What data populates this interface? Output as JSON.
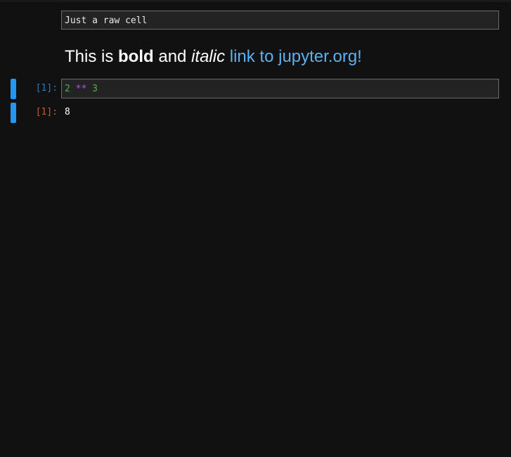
{
  "raw_cell": {
    "text": "Just a raw cell"
  },
  "markdown_cell": {
    "prefix": "This is ",
    "bold": "bold",
    "middle": " and ",
    "italic": "italic",
    "space": " ",
    "link_text": "link to jupyter.org!"
  },
  "code_cell": {
    "in_prompt": "[1]:",
    "tokens": {
      "num1": "2",
      "op": "**",
      "num2": "3"
    },
    "out_prompt": "[1]:",
    "output": "8"
  },
  "colors": {
    "background": "#111111",
    "collapser": "#2196f3",
    "in_prompt": "#2a7bbd",
    "out_prompt": "#c65c2d",
    "link": "#5db0ee"
  }
}
